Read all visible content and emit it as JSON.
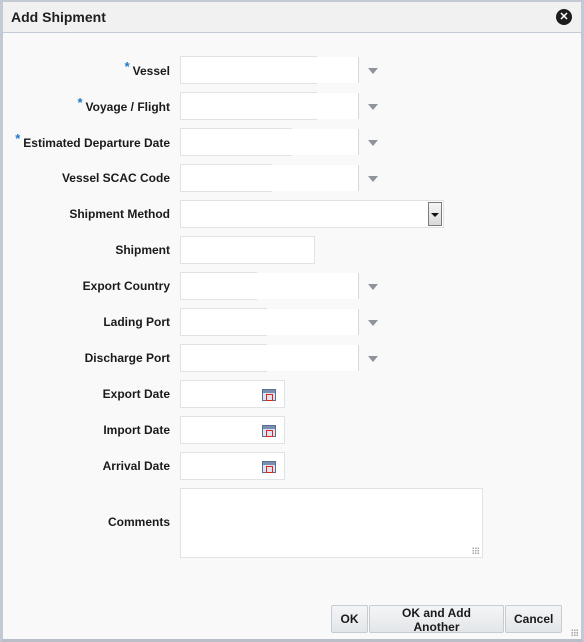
{
  "dialog": {
    "title": "Add Shipment",
    "close_icon": "close-circle-icon"
  },
  "form": {
    "fields": [
      {
        "label": "Vessel",
        "required": true,
        "type": "combobox",
        "value": ""
      },
      {
        "label": "Voyage / Flight",
        "required": true,
        "type": "combobox",
        "value": ""
      },
      {
        "label": "Estimated Departure Date",
        "required": true,
        "type": "combobox",
        "value": ""
      },
      {
        "label": "Vessel SCAC Code",
        "required": false,
        "type": "combobox",
        "value": ""
      },
      {
        "label": "Shipment Method",
        "required": false,
        "type": "select",
        "value": ""
      },
      {
        "label": "Shipment",
        "required": false,
        "type": "text",
        "value": ""
      },
      {
        "label": "Export Country",
        "required": false,
        "type": "combobox",
        "value": ""
      },
      {
        "label": "Lading Port",
        "required": false,
        "type": "combobox",
        "value": ""
      },
      {
        "label": "Discharge Port",
        "required": false,
        "type": "combobox",
        "value": ""
      },
      {
        "label": "Export Date",
        "required": false,
        "type": "date",
        "value": ""
      },
      {
        "label": "Import Date",
        "required": false,
        "type": "date",
        "value": ""
      },
      {
        "label": "Arrival Date",
        "required": false,
        "type": "date",
        "value": ""
      },
      {
        "label": "Comments",
        "required": false,
        "type": "textarea",
        "value": ""
      }
    ],
    "required_marker": "*"
  },
  "footer": {
    "ok_label": "OK",
    "ok_add_another_label": "OK and Add Another",
    "cancel_label": "Cancel"
  }
}
